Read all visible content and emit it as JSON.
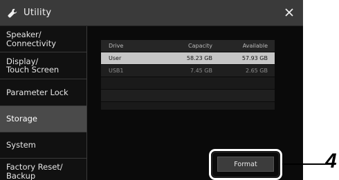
{
  "window": {
    "title": "Utility",
    "icon": "wrench-icon",
    "close_icon": "close-icon"
  },
  "sidebar": {
    "items": [
      {
        "label": "Speaker/\nConnectivity",
        "selected": false
      },
      {
        "label": "Display/\nTouch Screen",
        "selected": false
      },
      {
        "label": "Parameter Lock",
        "selected": false
      },
      {
        "label": "Storage",
        "selected": true
      },
      {
        "label": "System",
        "selected": false
      },
      {
        "label": "Factory Reset/\nBackup",
        "selected": false
      }
    ]
  },
  "storage_table": {
    "headers": {
      "drive": "Drive",
      "capacity": "Capacity",
      "available": "Available"
    },
    "rows": [
      {
        "drive": "User",
        "capacity": "58.23 GB",
        "available": "57.93 GB",
        "selected": true
      },
      {
        "drive": "USB1",
        "capacity": "7.45 GB",
        "available": "2.65 GB",
        "selected": false
      }
    ]
  },
  "format_button": {
    "label": "Format"
  },
  "callout": {
    "number": "4"
  },
  "colors": {
    "screen_bg": "#0a0a0a",
    "titlebar_bg": "#3a3a3a",
    "selected_nav_bg": "#4a4a4a",
    "selected_row_bg": "#c6c6c6"
  }
}
